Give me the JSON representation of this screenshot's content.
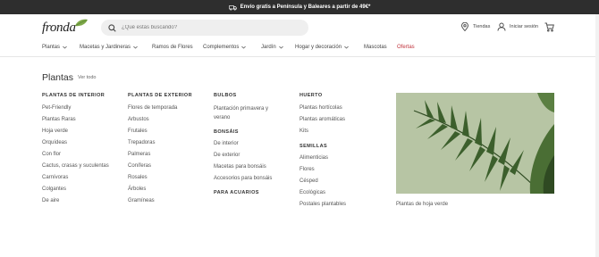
{
  "topbar": {
    "shipping_text": "Envío gratis a Península y Baleares a partir de 49€*"
  },
  "header": {
    "logo_text": "fronda",
    "search_placeholder": "¿Qué estás buscando?",
    "stores_label": "Tiendas",
    "login_label": "Iniciar sesión"
  },
  "nav": {
    "items": [
      {
        "label": "Plantas",
        "dropdown": true
      },
      {
        "label": "Macetas y Jardineras",
        "dropdown": true
      },
      {
        "label": "Ramos de Flores",
        "dropdown": false
      },
      {
        "label": "Complementos",
        "dropdown": true
      },
      {
        "label": "Jardín",
        "dropdown": true
      },
      {
        "label": "Hogar y decoración",
        "dropdown": true
      },
      {
        "label": "Mascotas",
        "dropdown": false
      },
      {
        "label": "Ofertas",
        "dropdown": false
      }
    ]
  },
  "menu": {
    "title": "Plantas",
    "view_all": "Ver todo",
    "col1": {
      "heading": "PLANTAS DE INTERIOR",
      "links": [
        "Pet-Friendly",
        "Plantas Raras",
        "Hoja verde",
        "Orquídeas",
        "Con flor",
        "Cactus, crasas y suculentas",
        "Carnívoras",
        "Colgantes",
        "De aire"
      ]
    },
    "col2": {
      "heading": "PLANTAS DE EXTERIOR",
      "links": [
        "Flores de temporada",
        "Arbustos",
        "Frutales",
        "Trepadoras",
        "Palmeras",
        "Coníferas",
        "Rosales",
        "Árboles",
        "Gramíneas"
      ]
    },
    "col3": {
      "bulbos_heading": "BULBOS",
      "bulbos_link": "Plantación primavera y verano",
      "bonsais_heading": "BONSÁIS",
      "bonsais_links": [
        "De interior",
        "De exterior",
        "Macetas para bonsáis",
        "Accesorios para bonsáis"
      ],
      "acuarios_heading": "PARA ACUARIOS"
    },
    "col4": {
      "huerto_heading": "HUERTO",
      "huerto_links": [
        "Plantas hortícolas",
        "Plantas aromáticas",
        "Kits"
      ],
      "semillas_heading": "SEMILLAS",
      "semillas_links": [
        "Alimenticias",
        "Flores",
        "Césped",
        "Ecológicas",
        "Postales plantables"
      ]
    },
    "promo_caption": "Plantas de hoja verde"
  },
  "colors": {
    "offer": "#c0333c",
    "topbar_bg": "#2e2e2e",
    "promo_bg": "#b5c3a2"
  }
}
